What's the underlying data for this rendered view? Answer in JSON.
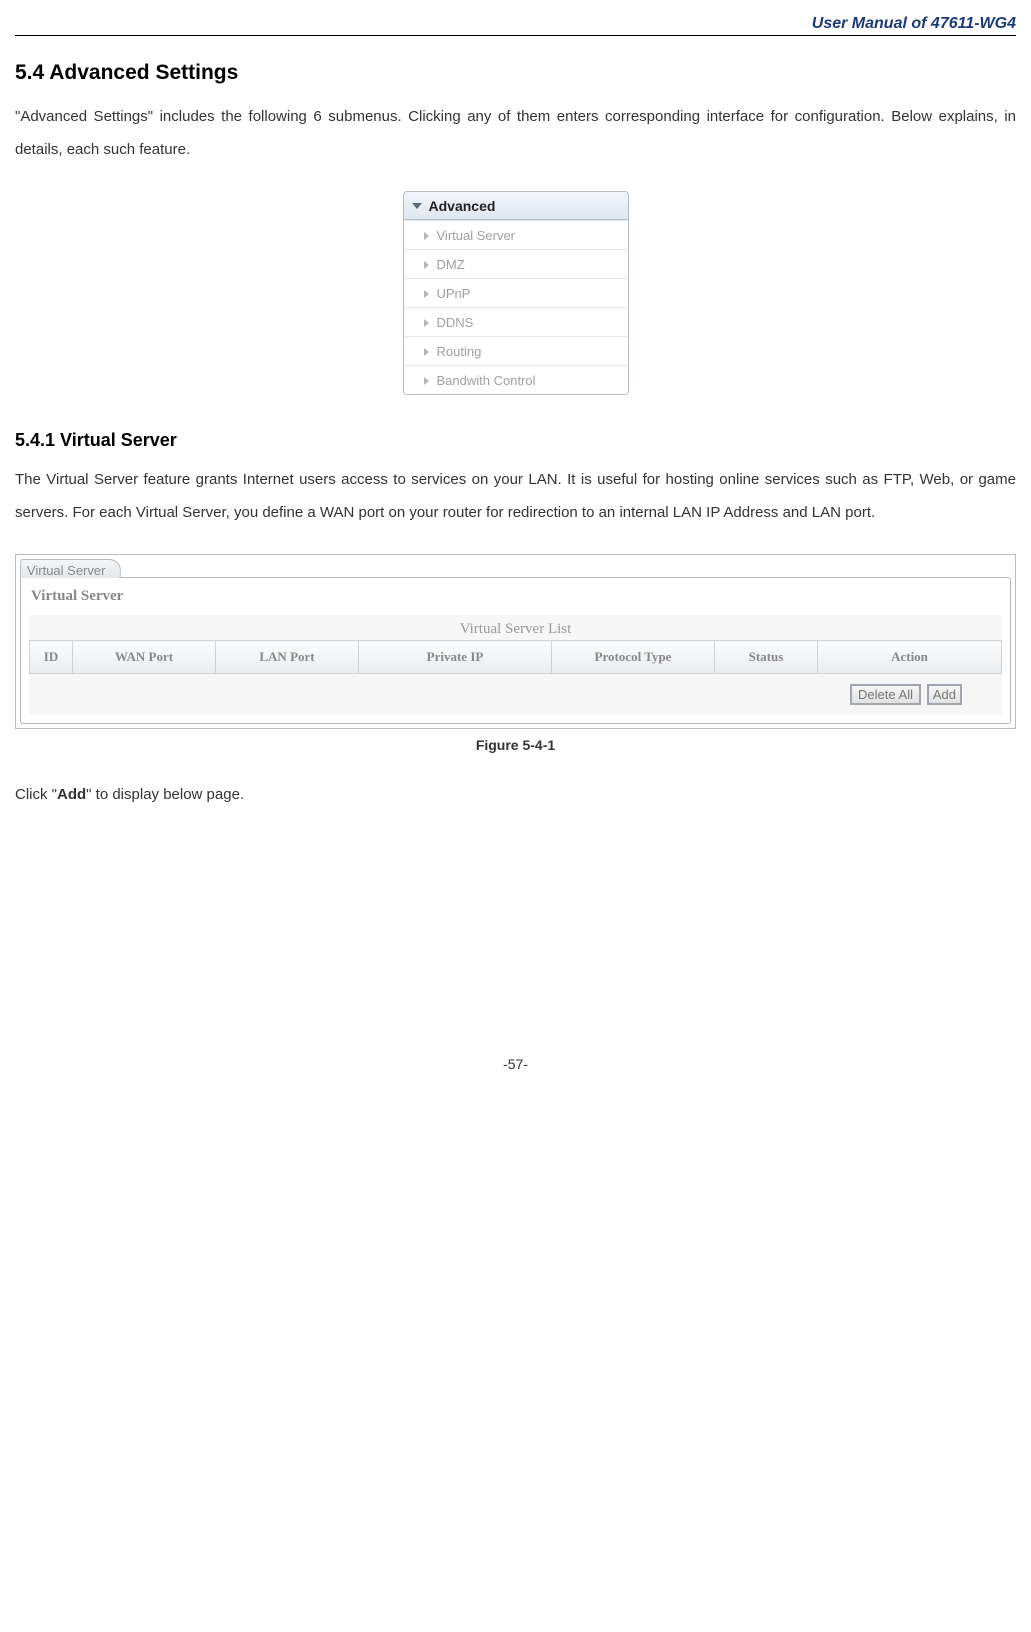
{
  "header": {
    "doc_title": "User Manual of 47611-WG4"
  },
  "section": {
    "title": "5.4  Advanced Settings",
    "intro": "\"Advanced Settings\" includes the following 6 submenus. Clicking any of them enters corresponding interface for configuration. Below explains, in details, each such feature."
  },
  "menu": {
    "title": "Advanced",
    "items": [
      {
        "label": "Virtual Server"
      },
      {
        "label": "DMZ"
      },
      {
        "label": "UPnP"
      },
      {
        "label": "DDNS"
      },
      {
        "label": "Routing"
      },
      {
        "label": "Bandwith Control"
      }
    ]
  },
  "subsection": {
    "title": "5.4.1  Virtual Server",
    "body": "The Virtual Server feature grants Internet users access to services on your LAN. It is useful for hosting online services such as FTP, Web, or game servers. For each Virtual Server, you define a WAN port on your router for redirection to an internal LAN IP Address and LAN port."
  },
  "vs_panel": {
    "tab": "Virtual Server",
    "panel_title": "Virtual Server",
    "list_title": "Virtual Server List",
    "columns": [
      "ID",
      "WAN Port",
      "LAN Port",
      "Private IP",
      "Protocol Type",
      "Status",
      "Action"
    ],
    "buttons": {
      "delete_all": "Delete All",
      "add": "Add"
    }
  },
  "figure_caption": "Figure 5-4-1",
  "after_figure": {
    "pre": "Click \"",
    "bold": "Add",
    "post": "\" to display below page."
  },
  "footer": {
    "page_num": "-57-"
  }
}
